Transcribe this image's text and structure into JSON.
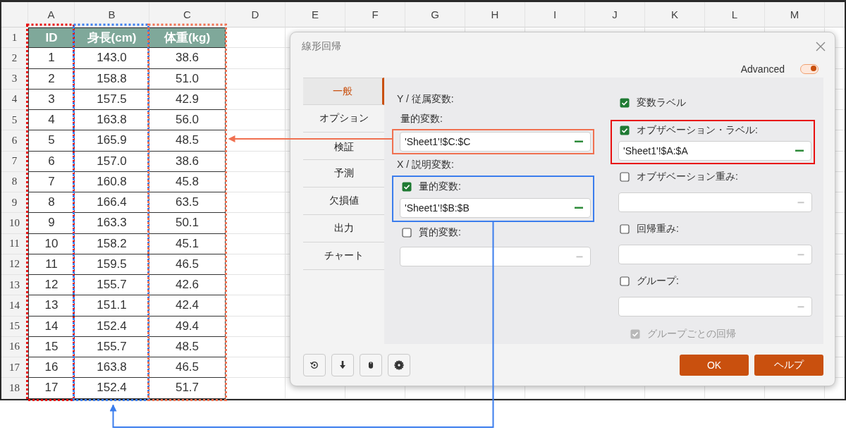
{
  "sheet": {
    "columns": [
      "A",
      "B",
      "C",
      "D",
      "E",
      "F",
      "G",
      "H",
      "I",
      "J",
      "K",
      "L",
      "M"
    ],
    "rows": [
      {
        "number": "1",
        "cells": [
          "ID",
          "身長(cm)",
          "体重(kg)"
        ]
      },
      {
        "number": "2",
        "cells": [
          "1",
          "143.0",
          "38.6"
        ]
      },
      {
        "number": "3",
        "cells": [
          "2",
          "158.8",
          "51.0"
        ]
      },
      {
        "number": "4",
        "cells": [
          "3",
          "157.5",
          "42.9"
        ]
      },
      {
        "number": "5",
        "cells": [
          "4",
          "163.8",
          "56.0"
        ]
      },
      {
        "number": "6",
        "cells": [
          "5",
          "165.9",
          "48.5"
        ]
      },
      {
        "number": "7",
        "cells": [
          "6",
          "157.0",
          "38.6"
        ]
      },
      {
        "number": "8",
        "cells": [
          "7",
          "160.8",
          "45.8"
        ]
      },
      {
        "number": "9",
        "cells": [
          "8",
          "166.4",
          "63.5"
        ]
      },
      {
        "number": "10",
        "cells": [
          "9",
          "163.3",
          "50.1"
        ]
      },
      {
        "number": "11",
        "cells": [
          "10",
          "158.2",
          "45.1"
        ]
      },
      {
        "number": "12",
        "cells": [
          "11",
          "159.5",
          "46.5"
        ]
      },
      {
        "number": "13",
        "cells": [
          "12",
          "155.7",
          "42.6"
        ]
      },
      {
        "number": "14",
        "cells": [
          "13",
          "151.1",
          "42.4"
        ]
      },
      {
        "number": "15",
        "cells": [
          "14",
          "152.4",
          "49.4"
        ]
      },
      {
        "number": "16",
        "cells": [
          "15",
          "155.7",
          "48.5"
        ]
      },
      {
        "number": "17",
        "cells": [
          "16",
          "163.8",
          "46.5"
        ]
      },
      {
        "number": "18",
        "cells": [
          "17",
          "152.4",
          "51.7"
        ]
      }
    ],
    "column_frames": [
      {
        "color": "#e81010"
      },
      {
        "color": "#3b7ded"
      },
      {
        "color": "#f07050"
      }
    ]
  },
  "dialog": {
    "title": "線形回帰",
    "advanced": {
      "label": "Advanced",
      "on": true
    },
    "tabs": [
      {
        "label": "一般",
        "selected": true
      },
      {
        "label": "オプション",
        "selected": false
      },
      {
        "label": "検証",
        "selected": false
      },
      {
        "label": "予測",
        "selected": false
      },
      {
        "label": "欠損値",
        "selected": false
      },
      {
        "label": "出力",
        "selected": false
      },
      {
        "label": "チャート",
        "selected": false
      }
    ],
    "dependent": {
      "heading": "Y / 従属変数:",
      "label": "量的変数:",
      "value": "'Sheet1'!$C:$C",
      "color": "#f07050"
    },
    "explanatory": {
      "heading": "X / 説明変数:",
      "options": [
        {
          "label": "量的変数:",
          "checked": true,
          "value": "'Sheet1'!$B:$B",
          "color": "#3b7ded"
        },
        {
          "label": "質的変数:",
          "checked": false
        }
      ]
    },
    "right_options": [
      {
        "kind": "check",
        "label": "変数ラベル",
        "checked": true
      },
      {
        "kind": "check-field",
        "label": "オブザベーション・ラベル:",
        "checked": true,
        "value": "'Sheet1'!$A:$A",
        "color": "#e81010"
      },
      {
        "kind": "check-field",
        "label": "オブザベーション重み:",
        "checked": false
      },
      {
        "kind": "check-field",
        "label": "回帰重み:",
        "checked": false
      },
      {
        "kind": "check-field",
        "label": "グループ:",
        "checked": false
      },
      {
        "kind": "sub-check",
        "label": "グループごとの回帰",
        "checked": true,
        "disabled": true
      }
    ],
    "buttons": [
      {
        "label": "OK"
      },
      {
        "label": "ヘルプ"
      }
    ]
  }
}
